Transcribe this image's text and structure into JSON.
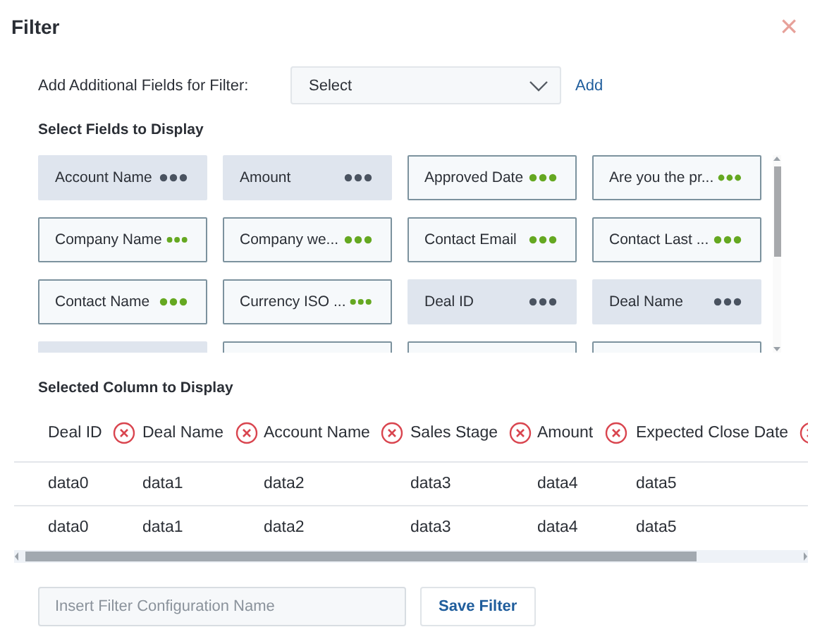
{
  "dialog": {
    "title": "Filter",
    "close": "×"
  },
  "additional_fields": {
    "label": "Add Additional Fields for Filter:",
    "placeholder": "Select",
    "add_link": "Add"
  },
  "fields_section": {
    "title": "Select Fields to Display",
    "fields": [
      {
        "label": "Account Name",
        "selected": true
      },
      {
        "label": "Amount",
        "selected": true
      },
      {
        "label": "Approved Date",
        "selected": false
      },
      {
        "label": "Are you the pr...",
        "selected": false
      },
      {
        "label": "Company Name",
        "selected": false
      },
      {
        "label": "Company we...",
        "selected": false
      },
      {
        "label": "Contact Email",
        "selected": false
      },
      {
        "label": "Contact Last ...",
        "selected": false
      },
      {
        "label": "Contact Name",
        "selected": false
      },
      {
        "label": "Currency ISO ...",
        "selected": false
      },
      {
        "label": "Deal ID",
        "selected": true
      },
      {
        "label": "Deal Name",
        "selected": true
      },
      {
        "selected": true
      },
      {
        "selected": false
      },
      {
        "selected": false
      },
      {
        "selected": false
      }
    ]
  },
  "selected_columns": {
    "title": "Selected Column to Display",
    "columns": [
      "Deal ID",
      "Deal Name",
      "Account Name",
      "Sales Stage",
      "Amount",
      "Expected Close Date"
    ],
    "rows": [
      [
        "data0",
        "data1",
        "data2",
        "data3",
        "data4",
        "data5"
      ],
      [
        "data0",
        "data1",
        "data2",
        "data3",
        "data4",
        "data5"
      ]
    ]
  },
  "save": {
    "placeholder": "Insert Filter Configuration Name",
    "button": "Save Filter"
  }
}
